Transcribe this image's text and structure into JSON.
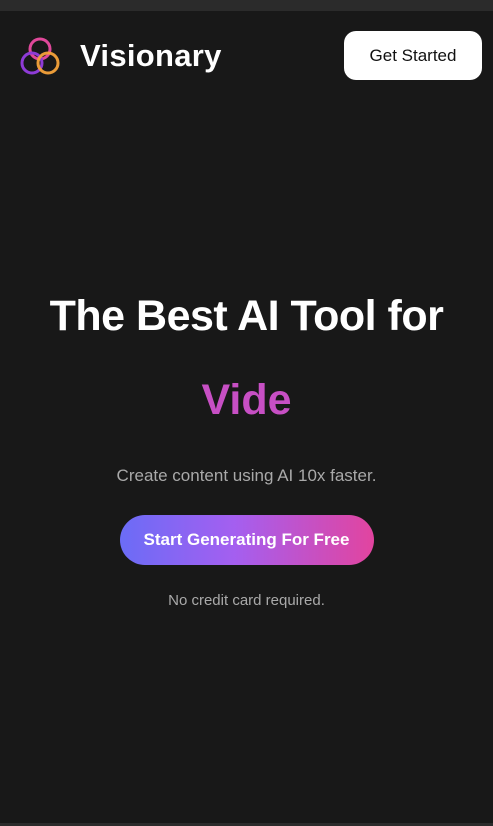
{
  "header": {
    "brand_name": "Visionary",
    "logo_icon": "triple-ring-logo-icon",
    "cta_label": "Get Started"
  },
  "hero": {
    "title": "The Best AI Tool for",
    "typed_word": "Vide",
    "subtitle": "Create content using AI 10x faster.",
    "cta_label": "Start Generating For Free",
    "note": "No credit card required."
  },
  "colors": {
    "background": "#181818",
    "accent_typed": "#c74fc4",
    "gradient_start": "#6b6cf6",
    "gradient_mid": "#a45ff0",
    "gradient_end": "#e2449f",
    "logo_ring_1": "#e0489a",
    "logo_ring_2": "#8e3bd6",
    "logo_ring_3": "#f6a23a"
  }
}
